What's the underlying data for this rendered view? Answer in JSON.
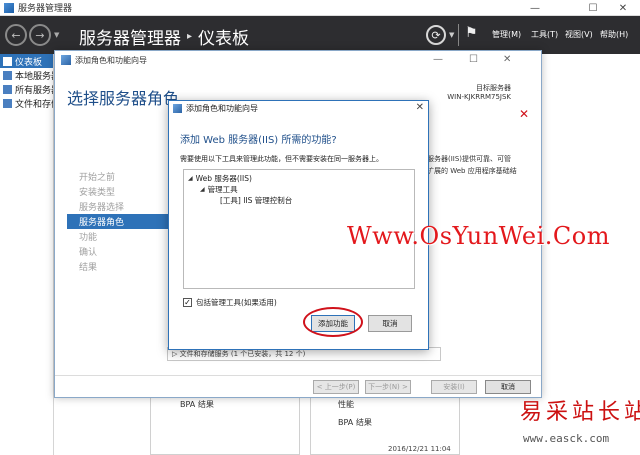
{
  "window": {
    "title": "服务器管理器",
    "minimize": "—",
    "maximize": "☐",
    "close": "✕"
  },
  "header": {
    "breadcrumb_root": "服务器管理器",
    "breadcrumb_sep": "▸",
    "breadcrumb_page": "仪表板",
    "menus": [
      "管理(M)",
      "工具(T)",
      "视图(V)",
      "帮助(H)"
    ]
  },
  "sidebar": {
    "items": [
      {
        "label": "仪表板",
        "active": true
      },
      {
        "label": "本地服务器",
        "active": false
      },
      {
        "label": "所有服务器",
        "active": false
      },
      {
        "label": "文件和存储服务",
        "active": false
      }
    ]
  },
  "background": {
    "bpa_left": "BPA 结果",
    "performance": "性能",
    "bpa_right": "BPA 结果",
    "timestamp": "2016/12/21 11:04"
  },
  "wizard": {
    "title": "添加角色和功能向导",
    "heading": "选择服务器角色",
    "dest_label": "目标服务器",
    "dest_server": "WIN-KJKRRM75JSK",
    "steps": [
      {
        "label": "开始之前",
        "current": false
      },
      {
        "label": "安装类型",
        "current": false
      },
      {
        "label": "服务器选择",
        "current": false
      },
      {
        "label": "服务器角色",
        "current": true
      },
      {
        "label": "功能",
        "current": false
      },
      {
        "label": "确认",
        "current": false
      },
      {
        "label": "结果",
        "current": false
      }
    ],
    "desc_line1": "服务器(IIS)提供可靠、可管",
    "desc_line2": "扩展的 Web 应用程序基础结",
    "list_footer": "▷  文件和存储服务 (1 个已安装，共 12 个)",
    "buttons": {
      "prev": "< 上一步(P)",
      "next": "下一步(N) >",
      "install": "安装(I)",
      "cancel": "取消"
    }
  },
  "dialog": {
    "title": "添加角色和功能向导",
    "close": "✕",
    "heading": "添加 Web 服务器(IIS) 所需的功能?",
    "description": "需要使用以下工具来管理此功能，但不需要安装在同一服务器上。",
    "tree": [
      {
        "label": "Web 服务器(IIS)",
        "level": 0,
        "expander": "◢"
      },
      {
        "label": "管理工具",
        "level": 1,
        "expander": "◢"
      },
      {
        "label": "[工具] IIS 管理控制台",
        "level": 2,
        "expander": ""
      }
    ],
    "checkbox_label": "包括管理工具(如果适用)",
    "checkbox_checked": true,
    "add_button": "添加功能",
    "cancel_button": "取消"
  },
  "watermarks": {
    "site_url": "Www.OsYunWei.Com",
    "cn_site": "易采站长站",
    "cn_url": "www.easck.com"
  },
  "colors": {
    "accent_blue": "#2e72b8",
    "header_dark": "#2d2d30",
    "highlight_red": "#d0121b",
    "watermark_red": "#e3181c"
  }
}
